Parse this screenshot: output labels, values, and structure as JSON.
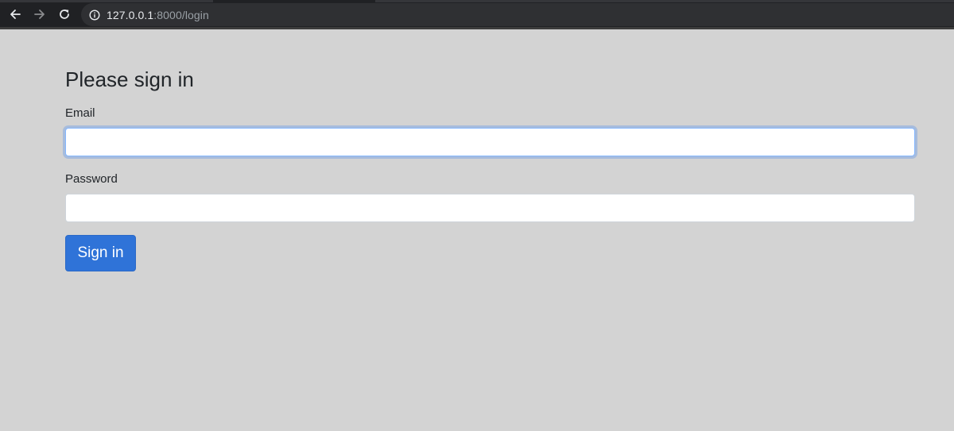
{
  "browser": {
    "url_host": "127.0.0.1",
    "url_rest": ":8000/login",
    "icons": {
      "back": "arrow-left-icon",
      "forward": "arrow-right-icon",
      "reload": "reload-icon",
      "site_info": "info-icon"
    }
  },
  "page": {
    "title": "Please sign in",
    "email_label": "Email",
    "email_value": "",
    "password_label": "Password",
    "password_value": "",
    "signin_label": "Sign in"
  },
  "colors": {
    "background": "#d3d3d3",
    "browser_chrome": "#202124",
    "primary_button": "#2f73d8",
    "focus_ring": "#86b7fe"
  }
}
